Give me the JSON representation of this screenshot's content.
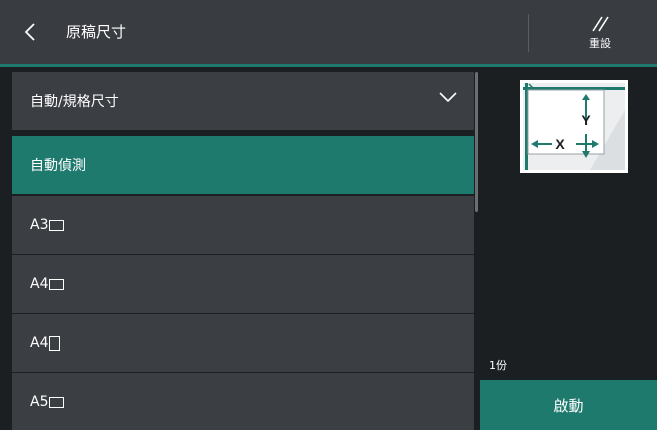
{
  "header": {
    "title": "原稿尺寸",
    "reset_label": "重設",
    "back_icon": "chevron-left-icon",
    "reset_icon": "double-slash-icon"
  },
  "size_list": {
    "items": [
      {
        "label": "自動/規格尺寸",
        "icon": "chevron-down-icon",
        "selected": false
      },
      {
        "label": "自動偵測",
        "selected": true
      },
      {
        "label": "A3",
        "orientation": "landscape",
        "selected": false
      },
      {
        "label": "A4",
        "orientation": "landscape",
        "selected": false
      },
      {
        "label": "A4",
        "orientation": "portrait",
        "selected": false
      },
      {
        "label": "A5",
        "orientation": "landscape",
        "selected": false
      }
    ]
  },
  "preview": {
    "axis_x": "X",
    "axis_y": "Y"
  },
  "footer": {
    "copies": "1份",
    "start_label": "啟動"
  },
  "colors": {
    "background": "#1b1f22",
    "header": "#393c40",
    "list_item": "#3b3f43",
    "accent": "#1f7a6e",
    "preview_arrow": "#1f7a6e"
  }
}
